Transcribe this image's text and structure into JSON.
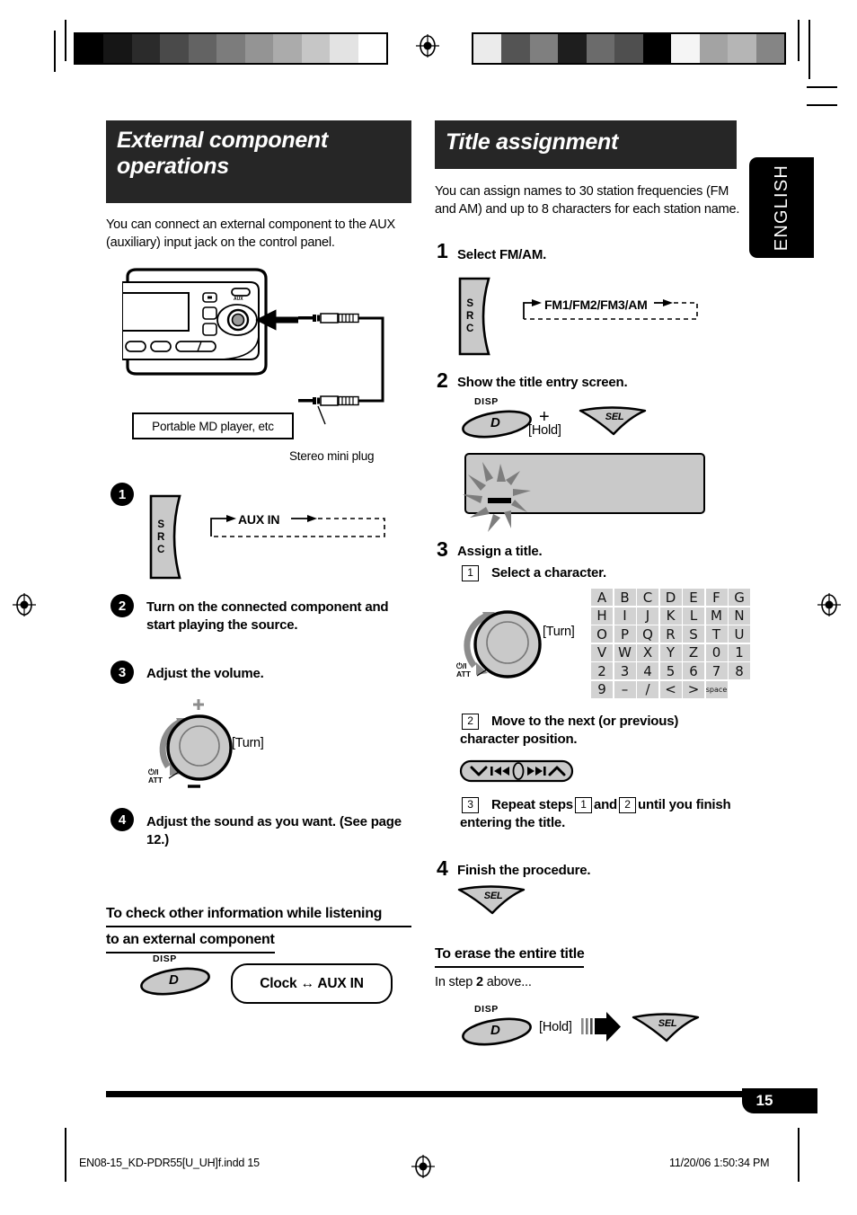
{
  "page": {
    "number": "15",
    "language_tab": "ENGLISH",
    "print_filename": "EN08-15_KD-PDR55[U_UH]f.indd   15",
    "print_timestamp": "11/20/06   1:50:34 PM"
  },
  "left_column": {
    "title": "External component operations",
    "intro": "You can connect an external component to the AUX (auxiliary) input jack on the control panel.",
    "diagram": {
      "device_label": "Portable MD player, etc",
      "plug_label": "Stereo mini plug",
      "aux_port_label": "AUX"
    },
    "steps": [
      {
        "num": "1",
        "text": "",
        "button": "SRC",
        "flow": "AUX IN"
      },
      {
        "num": "2",
        "text": "Turn on the connected component and start playing the source."
      },
      {
        "num": "3",
        "text": "Adjust the volume.",
        "knob_hint": "[Turn]",
        "knob_plus": "+",
        "knob_minus": "—",
        "knob_att": "ATT"
      },
      {
        "num": "4",
        "text": "Adjust the sound as you want. (See page 12.)"
      }
    ],
    "subsection": {
      "heading_line1": "To check other information while listening",
      "heading_line2": "to an external component",
      "button_cap": "DISP",
      "button_glyph": "D",
      "pill_text": "Clock ↔ AUX IN"
    }
  },
  "right_column": {
    "title": "Title assignment",
    "intro": "You can assign names to 30 station frequencies (FM and AM) and up to 8 characters for each station name.",
    "steps": [
      {
        "num": "1",
        "text": "Select FM/AM.",
        "button": "SRC",
        "flow": "FM1/FM2/FM3/AM"
      },
      {
        "num": "2",
        "text": "Show the title entry screen.",
        "disp_cap": "DISP",
        "disp_glyph": "D",
        "plus": "+",
        "hold": "[Hold]",
        "sel_label": "SEL"
      },
      {
        "num": "3",
        "text": "Assign a title.",
        "substeps": [
          {
            "num": "1",
            "text": "Select a character.",
            "knob_hint": "[Turn]",
            "knob_att": "ATT"
          },
          {
            "num": "2",
            "text": "Move to the next (or previous) character position."
          },
          {
            "num": "3",
            "text_before": "Repeat steps",
            "ref1": "1",
            "text_mid": "and",
            "ref2": "2",
            "text_after": "until you finish entering the title."
          }
        ],
        "char_table": [
          [
            "A",
            "B",
            "C",
            "D",
            "E",
            "F",
            "G"
          ],
          [
            "H",
            "I",
            "J",
            "K",
            "L",
            "M",
            "N"
          ],
          [
            "O",
            "P",
            "Q",
            "R",
            "S",
            "T",
            "U"
          ],
          [
            "V",
            "W",
            "X",
            "Y",
            "Z",
            "0",
            "1"
          ],
          [
            "2",
            "3",
            "4",
            "5",
            "6",
            "7",
            "8"
          ],
          [
            "9",
            "–",
            "/",
            "<",
            ">",
            "space"
          ]
        ]
      },
      {
        "num": "4",
        "text": "Finish the procedure.",
        "sel_label": "SEL"
      }
    ],
    "subsection": {
      "heading": "To erase the entire title",
      "intro_before": "In step",
      "intro_num": "2",
      "intro_after": "above...",
      "button_cap": "DISP",
      "button_glyph": "D",
      "hold": "[Hold]",
      "sel_label": "SEL"
    }
  },
  "calibration": {
    "left_strip": [
      "#000000",
      "#161616",
      "#2b2b2b",
      "#4a4a4a",
      "#636363",
      "#7c7c7c",
      "#949494",
      "#ababab",
      "#c6c6c6",
      "#e3e3e3",
      "#ffffff"
    ],
    "right_strip": [
      "#ebebeb",
      "#545454",
      "#7f7f7f",
      "#1e1e1e",
      "#6b6b6b",
      "#4f4f4f",
      "#000000",
      "#f5f5f5",
      "#a3a3a3",
      "#b5b5b5",
      "#858585"
    ]
  },
  "colors": {
    "banner_bg": "#262626",
    "button_gray": "#c9c9c9",
    "table_cell": "#d2d2d2"
  }
}
